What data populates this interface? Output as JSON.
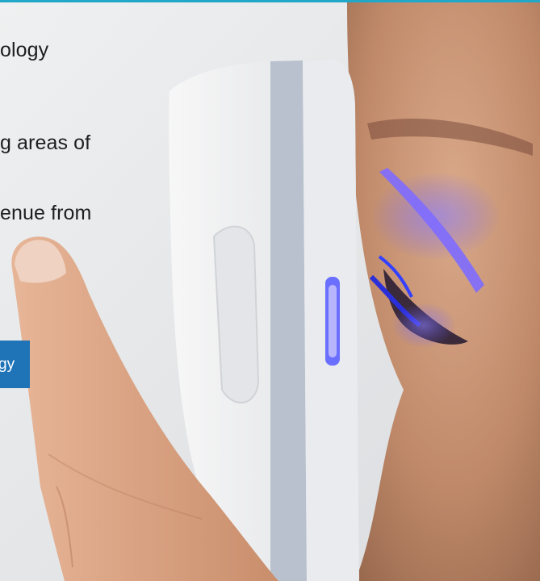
{
  "hero": {
    "lines": [
      "ology",
      "g areas of",
      "enue from"
    ],
    "cta_label": "gy"
  },
  "colors": {
    "accent_bar": "#21a8c9",
    "cta_background": "#1f74b8",
    "eye_light": "#6b5bff"
  },
  "icons": {
    "hero_image": "handheld-eye-scanner-photo"
  }
}
